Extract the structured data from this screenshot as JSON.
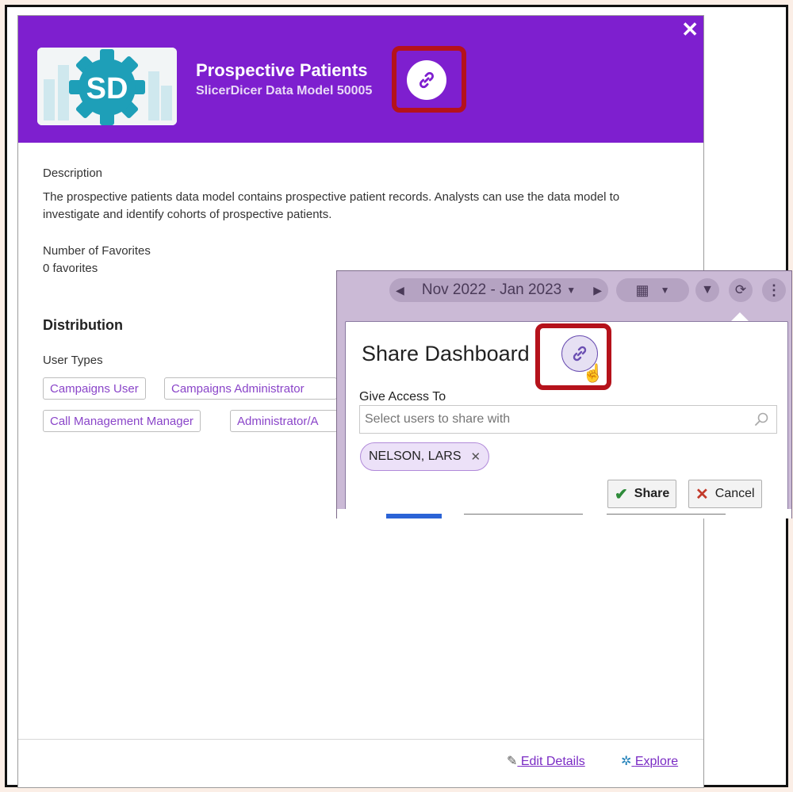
{
  "modal": {
    "close_glyph": "✕",
    "logo_letters": "SD",
    "title": "Prospective Patients",
    "subtitle": "SlicerDicer Data Model 50005",
    "description_label": "Description",
    "description_text": "The prospective patients data model contains prospective patient records. Analysts can use the data model to investigate and identify cohorts of prospective patients.",
    "favorites_label": "Number of Favorites",
    "favorites_value": "0 favorites",
    "distribution_title": "Distribution",
    "user_types_label": "User Types",
    "user_types": [
      "Campaigns User",
      "Campaigns Administrator",
      "Call Management Manager",
      "Administrator/A"
    ],
    "footer": {
      "edit_label": "Edit Details",
      "explore_label": "Explore"
    }
  },
  "share_popup": {
    "toolbar": {
      "date_range": "Nov 2022 - Jan 2023"
    },
    "title": "Share Dashboard",
    "give_access_label": "Give Access To",
    "input_placeholder": "Select users to share with",
    "selected_user": "NELSON, LARS",
    "share_button": "Share",
    "cancel_button": "Cancel"
  },
  "colors": {
    "header_purple": "#7e1fcf",
    "highlight_red": "#b5121b",
    "link_purple": "#7a2bc4"
  }
}
